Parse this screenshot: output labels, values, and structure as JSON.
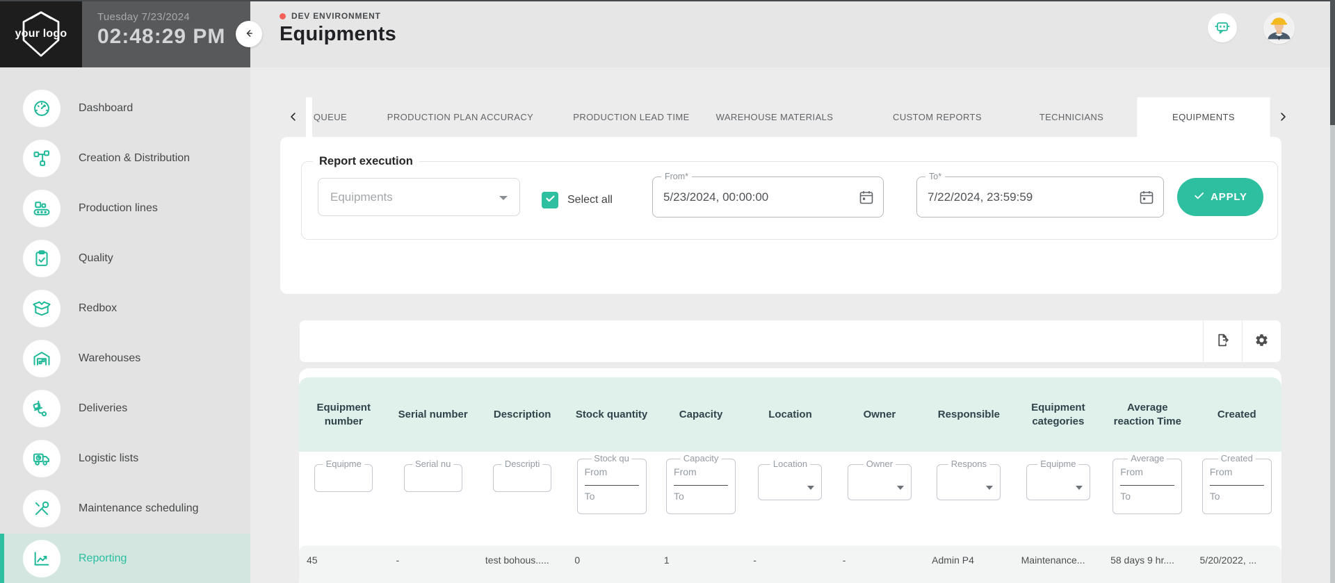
{
  "topbar": {
    "logo_text": "your logo",
    "date": "Tuesday 7/23/2024",
    "time": "02:48:29 PM",
    "env_label": "DEV ENVIRONMENT",
    "page_title": "Equipments"
  },
  "sidebar": {
    "items": [
      {
        "label": "Dashboard",
        "icon": "gauge-icon",
        "active": false
      },
      {
        "label": "Creation & Distribution",
        "icon": "distribution-icon",
        "active": false
      },
      {
        "label": "Production lines",
        "icon": "conveyor-icon",
        "active": false
      },
      {
        "label": "Quality",
        "icon": "clipboard-check-icon",
        "active": false
      },
      {
        "label": "Redbox",
        "icon": "open-box-icon",
        "active": false
      },
      {
        "label": "Warehouses",
        "icon": "warehouse-icon",
        "active": false
      },
      {
        "label": "Deliveries",
        "icon": "hand-truck-icon",
        "active": false
      },
      {
        "label": "Logistic lists",
        "icon": "truck-icon",
        "active": false
      },
      {
        "label": "Maintenance scheduling",
        "icon": "tools-icon",
        "active": false
      },
      {
        "label": "Reporting",
        "icon": "chart-line-icon",
        "active": true
      }
    ]
  },
  "tabs": {
    "items": [
      {
        "label": "QUEUE"
      },
      {
        "label": "PRODUCTION PLAN ACCURACY"
      },
      {
        "label": "PRODUCTION LEAD TIME"
      },
      {
        "label": "WAREHOUSE MATERIALS"
      },
      {
        "label": "CUSTOM REPORTS"
      },
      {
        "label": "TECHNICIANS"
      },
      {
        "label": "EQUIPMENTS"
      }
    ],
    "active": "EQUIPMENTS"
  },
  "report_execution": {
    "legend": "Report execution",
    "report_select_value": "Equipments",
    "select_all_label": "Select all",
    "select_all_checked": true,
    "from_field": {
      "label": "From*",
      "value": "5/23/2024, 00:00:00",
      "icon": "calendar-icon"
    },
    "to_field": {
      "label": "To*",
      "value": "7/22/2024, 23:59:59",
      "icon": "calendar-icon"
    },
    "apply_label": "APPLY"
  },
  "toolbar": {
    "icons": [
      "export-icon",
      "gear-icon"
    ]
  },
  "table": {
    "columns": [
      "Equipment number",
      "Serial number",
      "Description",
      "Stock quantity",
      "Capacity",
      "Location",
      "Owner",
      "Responsible",
      "Equipment categories",
      "Average reaction Time",
      "Created"
    ],
    "filters": [
      {
        "label": "Equipme",
        "type": "text"
      },
      {
        "label": "Serial nu",
        "type": "text"
      },
      {
        "label": "Descripti",
        "type": "text"
      },
      {
        "label": "Stock qu",
        "type": "range"
      },
      {
        "label": "Capacity",
        "type": "range"
      },
      {
        "label": "Location",
        "type": "select"
      },
      {
        "label": "Owner",
        "type": "select"
      },
      {
        "label": "Respons",
        "type": "select"
      },
      {
        "label": "Equipme",
        "type": "select"
      },
      {
        "label": "Average",
        "type": "range"
      },
      {
        "label": "Created",
        "type": "range"
      }
    ],
    "range_from": "From",
    "range_to": "To",
    "rows": [
      {
        "cells": [
          "45",
          "-",
          "test bohous.....",
          "0",
          "1",
          "-",
          "-",
          "Admin P4",
          "Maintenance...",
          "58 days 9 hr....",
          "5/20/2022, ..."
        ]
      }
    ]
  },
  "colors": {
    "accent": "#2ebfa0",
    "icon_teal": "#1eb998",
    "table_header_bg": "#dff1ea",
    "sidebar_active_bg": "#d4e6e0",
    "env_dot_red": "#f4605a",
    "row_stripe": "#f3f4f4"
  }
}
